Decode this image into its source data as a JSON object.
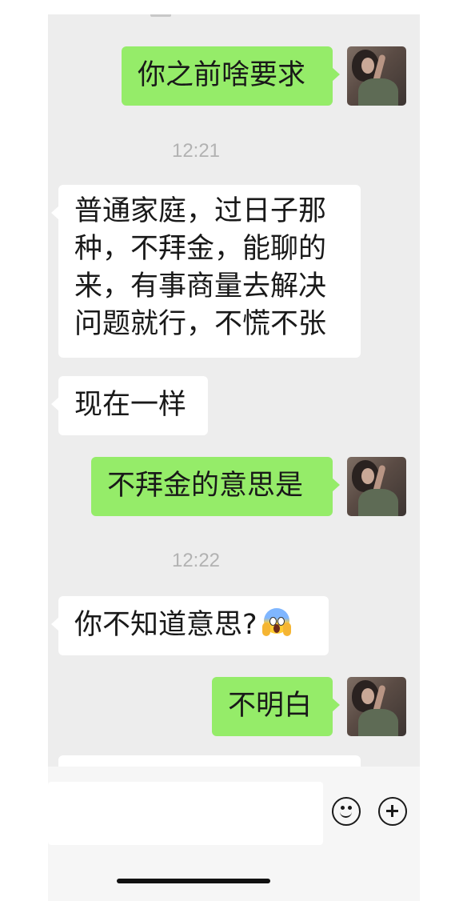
{
  "messages": [
    {
      "side": "out",
      "text": "你之前啥要求"
    },
    {
      "time": "12:21"
    },
    {
      "side": "in",
      "lines": [
        "普通家庭，过日子那",
        "种，不拜金，能聊的",
        "来，有事商量去解决",
        "问题就行，不慌不张"
      ]
    },
    {
      "side": "in",
      "text": "现在一样"
    },
    {
      "side": "out",
      "text": "不拜金的意思是"
    },
    {
      "time": "12:22"
    },
    {
      "side": "in",
      "text": "你不知道意思?",
      "emoji": "face-screaming-in-fear"
    },
    {
      "side": "out",
      "text": "不明白"
    }
  ],
  "input_bar": {
    "value": "",
    "icons": [
      "emoji-icon",
      "plus-icon"
    ]
  },
  "colors": {
    "outgoing_bubble": "#95ec69",
    "incoming_bubble": "#ffffff",
    "chat_background": "#ededed",
    "timestamp": "#b2b2b2"
  }
}
